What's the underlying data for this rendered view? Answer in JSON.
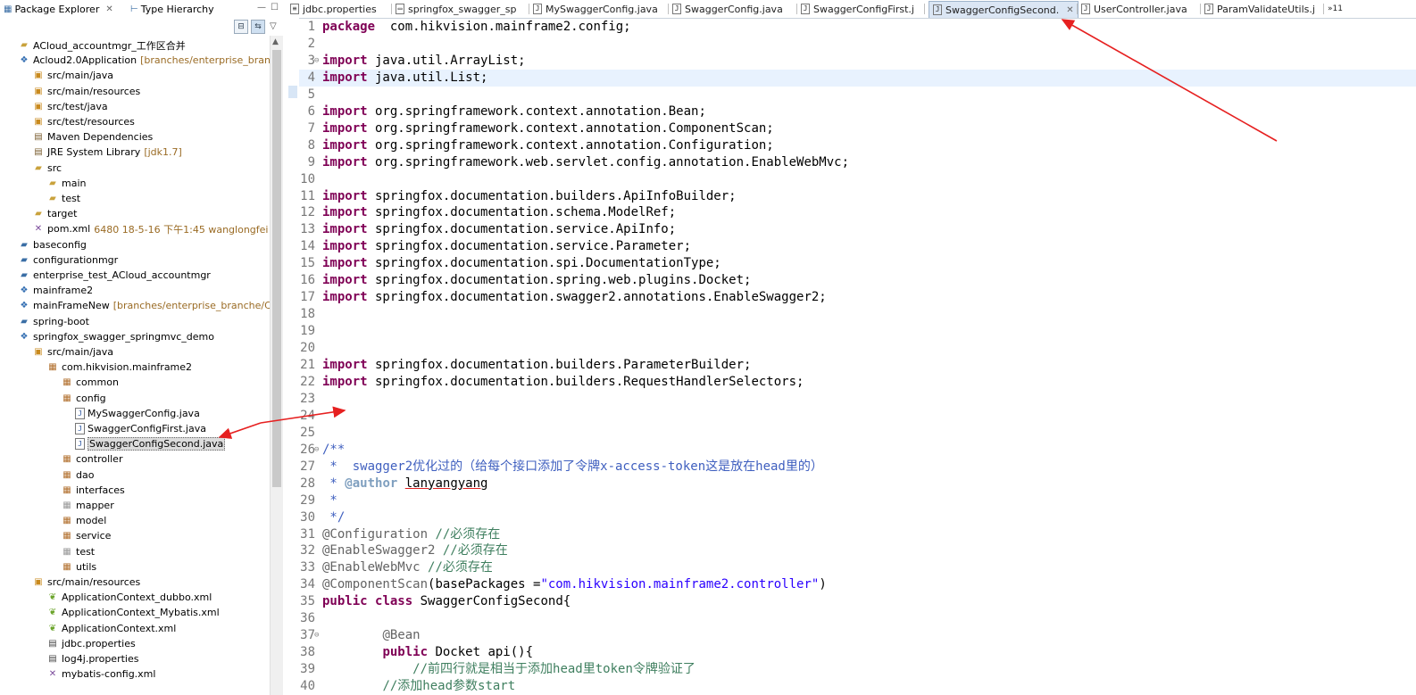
{
  "explorer": {
    "tabs": [
      {
        "label": "Package Explorer",
        "icon": "package-explorer-icon",
        "active": true
      },
      {
        "label": "Type Hierarchy",
        "icon": "type-hierarchy-icon",
        "active": false
      }
    ],
    "items": [
      {
        "label": "ACloud_accountmgr_工作区合并",
        "icon": "folder-icon",
        "deco": ""
      },
      {
        "label": "Acloud2.0Application",
        "icon": "maven-project-icon",
        "deco": "[branches/enterprise_branche/"
      },
      {
        "label": "src/main/java",
        "icon": "source-folder-icon",
        "deco": ""
      },
      {
        "label": "src/main/resources",
        "icon": "source-folder-icon",
        "deco": ""
      },
      {
        "label": "src/test/java",
        "icon": "source-folder-icon",
        "deco": ""
      },
      {
        "label": "src/test/resources",
        "icon": "source-folder-icon",
        "deco": ""
      },
      {
        "label": "Maven Dependencies",
        "icon": "library-icon",
        "deco": ""
      },
      {
        "label": "JRE System Library",
        "icon": "library-icon",
        "deco": "[jdk1.7]"
      },
      {
        "label": "src",
        "icon": "folder-icon",
        "deco": ""
      },
      {
        "label": "main",
        "icon": "folder-icon",
        "deco": ""
      },
      {
        "label": "test",
        "icon": "folder-icon",
        "deco": ""
      },
      {
        "label": "target",
        "icon": "folder-icon",
        "deco": ""
      },
      {
        "label": "pom.xml",
        "icon": "xml-file-icon",
        "deco": "6480  18-5-16 下午1:45  wanglongfei"
      },
      {
        "label": "baseconfig",
        "icon": "project-icon",
        "deco": ""
      },
      {
        "label": "configurationmgr",
        "icon": "project-icon",
        "deco": ""
      },
      {
        "label": "enterprise_test_ACloud_accountmgr",
        "icon": "project-icon",
        "deco": ""
      },
      {
        "label": "mainframe2",
        "icon": "maven-project-icon",
        "deco": ""
      },
      {
        "label": "mainFrameNew",
        "icon": "maven-project-icon",
        "deco": "[branches/enterprise_branche/Clouc"
      },
      {
        "label": "spring-boot",
        "icon": "project-icon",
        "deco": ""
      },
      {
        "label": "springfox_swagger_springmvc_demo",
        "icon": "maven-project-icon",
        "deco": ""
      },
      {
        "label": "src/main/java",
        "icon": "source-folder-icon",
        "deco": ""
      },
      {
        "label": "com.hikvision.mainframe2",
        "icon": "package-icon",
        "deco": ""
      },
      {
        "label": "common",
        "icon": "package-icon",
        "deco": ""
      },
      {
        "label": "config",
        "icon": "package-icon",
        "deco": ""
      },
      {
        "label": "MySwaggerConfig.java",
        "icon": "java-file-icon",
        "deco": ""
      },
      {
        "label": "SwaggerConfigFirst.java",
        "icon": "java-file-icon",
        "deco": ""
      },
      {
        "label": "SwaggerConfigSecond.java",
        "icon": "java-file-icon",
        "deco": ""
      },
      {
        "label": "controller",
        "icon": "package-icon",
        "deco": ""
      },
      {
        "label": "dao",
        "icon": "package-icon",
        "deco": ""
      },
      {
        "label": "interfaces",
        "icon": "package-icon",
        "deco": ""
      },
      {
        "label": "mapper",
        "icon": "empty-package-icon",
        "deco": ""
      },
      {
        "label": "model",
        "icon": "package-icon",
        "deco": ""
      },
      {
        "label": "service",
        "icon": "package-icon",
        "deco": ""
      },
      {
        "label": "test",
        "icon": "empty-package-icon",
        "deco": ""
      },
      {
        "label": "utils",
        "icon": "package-icon",
        "deco": ""
      },
      {
        "label": "src/main/resources",
        "icon": "source-folder-icon",
        "deco": ""
      },
      {
        "label": "ApplicationContext_dubbo.xml",
        "icon": "spring-xml-icon",
        "deco": ""
      },
      {
        "label": "ApplicationContext_Mybatis.xml",
        "icon": "spring-xml-icon",
        "deco": ""
      },
      {
        "label": "ApplicationContext.xml",
        "icon": "spring-xml-icon",
        "deco": ""
      },
      {
        "label": "jdbc.properties",
        "icon": "properties-file-icon",
        "deco": ""
      },
      {
        "label": "log4j.properties",
        "icon": "properties-file-icon",
        "deco": ""
      },
      {
        "label": "mybatis-config.xml",
        "icon": "xml-file-icon",
        "deco": ""
      }
    ]
  },
  "editor": {
    "tabs": [
      {
        "label": "jdbc.properties",
        "active": false
      },
      {
        "label": "springfox_swagger_sp",
        "active": false
      },
      {
        "label": "MySwaggerConfig.java",
        "active": false
      },
      {
        "label": "SwaggerConfig.java",
        "active": false
      },
      {
        "label": "SwaggerConfigFirst.j",
        "active": false
      },
      {
        "label": "SwaggerConfigSecond.",
        "active": true
      },
      {
        "label": "UserController.java",
        "active": false
      },
      {
        "label": "ParamValidateUtils.j",
        "active": false
      },
      {
        "label": "»11",
        "active": false
      }
    ],
    "code_lines": [
      {
        "n": "1",
        "fold": "",
        "tokens": [
          [
            "kw",
            "package"
          ],
          [
            "",
            "  com.hikvision.mainframe2.config;"
          ]
        ]
      },
      {
        "n": "2",
        "fold": "",
        "tokens": []
      },
      {
        "n": "3",
        "fold": "⊖",
        "tokens": [
          [
            "kw",
            "import"
          ],
          [
            "",
            " java.util.ArrayList;"
          ]
        ]
      },
      {
        "n": "4",
        "fold": "",
        "tokens": [
          [
            "kw",
            "import"
          ],
          [
            "",
            " java.util.List;"
          ]
        ],
        "current": true
      },
      {
        "n": "5",
        "fold": "",
        "tokens": []
      },
      {
        "n": "6",
        "fold": "",
        "tokens": [
          [
            "kw",
            "import"
          ],
          [
            "",
            " org.springframework.context.annotation.Bean;"
          ]
        ]
      },
      {
        "n": "7",
        "fold": "",
        "tokens": [
          [
            "kw",
            "import"
          ],
          [
            "",
            " org.springframework.context.annotation.ComponentScan;"
          ]
        ]
      },
      {
        "n": "8",
        "fold": "",
        "tokens": [
          [
            "kw",
            "import"
          ],
          [
            "",
            " org.springframework.context.annotation.Configuration;"
          ]
        ]
      },
      {
        "n": "9",
        "fold": "",
        "tokens": [
          [
            "kw",
            "import"
          ],
          [
            "",
            " org.springframework.web.servlet.config.annotation.EnableWebMvc;"
          ]
        ]
      },
      {
        "n": "10",
        "fold": "",
        "tokens": []
      },
      {
        "n": "11",
        "fold": "",
        "tokens": [
          [
            "kw",
            "import"
          ],
          [
            "",
            " springfox.documentation.builders.ApiInfoBuilder;"
          ]
        ]
      },
      {
        "n": "12",
        "fold": "",
        "tokens": [
          [
            "kw",
            "import"
          ],
          [
            "",
            " springfox.documentation.schema.ModelRef;"
          ]
        ]
      },
      {
        "n": "13",
        "fold": "",
        "tokens": [
          [
            "kw",
            "import"
          ],
          [
            "",
            " springfox.documentation.service.ApiInfo;"
          ]
        ]
      },
      {
        "n": "14",
        "fold": "",
        "tokens": [
          [
            "kw",
            "import"
          ],
          [
            "",
            " springfox.documentation.service.Parameter;"
          ]
        ]
      },
      {
        "n": "15",
        "fold": "",
        "tokens": [
          [
            "kw",
            "import"
          ],
          [
            "",
            " springfox.documentation.spi.DocumentationType;"
          ]
        ]
      },
      {
        "n": "16",
        "fold": "",
        "tokens": [
          [
            "kw",
            "import"
          ],
          [
            "",
            " springfox.documentation.spring.web.plugins.Docket;"
          ]
        ]
      },
      {
        "n": "17",
        "fold": "",
        "tokens": [
          [
            "kw",
            "import"
          ],
          [
            "",
            " springfox.documentation.swagger2.annotations.EnableSwagger2;"
          ]
        ]
      },
      {
        "n": "18",
        "fold": "",
        "tokens": []
      },
      {
        "n": "19",
        "fold": "",
        "tokens": []
      },
      {
        "n": "20",
        "fold": "",
        "tokens": []
      },
      {
        "n": "21",
        "fold": "",
        "tokens": [
          [
            "kw",
            "import"
          ],
          [
            "",
            " springfox.documentation.builders.ParameterBuilder;"
          ]
        ]
      },
      {
        "n": "22",
        "fold": "",
        "tokens": [
          [
            "kw",
            "import"
          ],
          [
            "",
            " springfox.documentation.builders.RequestHandlerSelectors;"
          ]
        ]
      },
      {
        "n": "23",
        "fold": "",
        "tokens": []
      },
      {
        "n": "24",
        "fold": "",
        "tokens": []
      },
      {
        "n": "25",
        "fold": "",
        "tokens": []
      },
      {
        "n": "26",
        "fold": "⊖",
        "tokens": [
          [
            "jd",
            "/**"
          ]
        ]
      },
      {
        "n": "27",
        "fold": "",
        "tokens": [
          [
            "jd",
            " *  swagger2优化过的（给每个接口添加了令牌x-access-token这是放在head里的）"
          ]
        ]
      },
      {
        "n": "28",
        "fold": "",
        "tokens": [
          [
            "jd",
            " * "
          ],
          [
            "jdt",
            "@author"
          ],
          [
            "jd",
            " "
          ],
          [
            "jdu",
            "lanyangyang"
          ]
        ]
      },
      {
        "n": "29",
        "fold": "",
        "tokens": [
          [
            "jd",
            " *"
          ]
        ]
      },
      {
        "n": "30",
        "fold": "",
        "tokens": [
          [
            "jd",
            " */"
          ]
        ]
      },
      {
        "n": "31",
        "fold": "",
        "tokens": [
          [
            "an",
            "@Configuration"
          ],
          [
            "",
            " "
          ],
          [
            "cm",
            "//必须存在"
          ]
        ]
      },
      {
        "n": "32",
        "fold": "",
        "tokens": [
          [
            "an",
            "@EnableSwagger2"
          ],
          [
            "",
            " "
          ],
          [
            "cm",
            "//必须存在"
          ]
        ]
      },
      {
        "n": "33",
        "fold": "",
        "tokens": [
          [
            "an",
            "@EnableWebMvc"
          ],
          [
            "",
            " "
          ],
          [
            "cm",
            "//必须存在"
          ]
        ]
      },
      {
        "n": "34",
        "fold": "",
        "tokens": [
          [
            "an",
            "@ComponentScan"
          ],
          [
            "",
            "(basePackages ="
          ],
          [
            "str",
            "\"com.hikvision.mainframe2.controller\""
          ],
          [
            "",
            ")"
          ]
        ]
      },
      {
        "n": "35",
        "fold": "",
        "tokens": [
          [
            "kw",
            "public"
          ],
          [
            "",
            " "
          ],
          [
            "kw",
            "class"
          ],
          [
            "",
            " SwaggerConfigSecond{"
          ]
        ]
      },
      {
        "n": "36",
        "fold": "",
        "tokens": []
      },
      {
        "n": "37",
        "fold": "⊖",
        "tokens": [
          [
            "",
            "        "
          ],
          [
            "an",
            "@Bean"
          ]
        ]
      },
      {
        "n": "38",
        "fold": "",
        "tokens": [
          [
            "",
            "        "
          ],
          [
            "kw",
            "public"
          ],
          [
            "",
            " Docket api(){"
          ]
        ]
      },
      {
        "n": "39",
        "fold": "",
        "tokens": [
          [
            "",
            "            "
          ],
          [
            "cm",
            "//前四行就是相当于添加head里token令牌验证了"
          ]
        ]
      },
      {
        "n": "40",
        "fold": "",
        "tokens": [
          [
            "",
            "        "
          ],
          [
            "cm",
            "//添加head参数start"
          ]
        ]
      }
    ]
  }
}
